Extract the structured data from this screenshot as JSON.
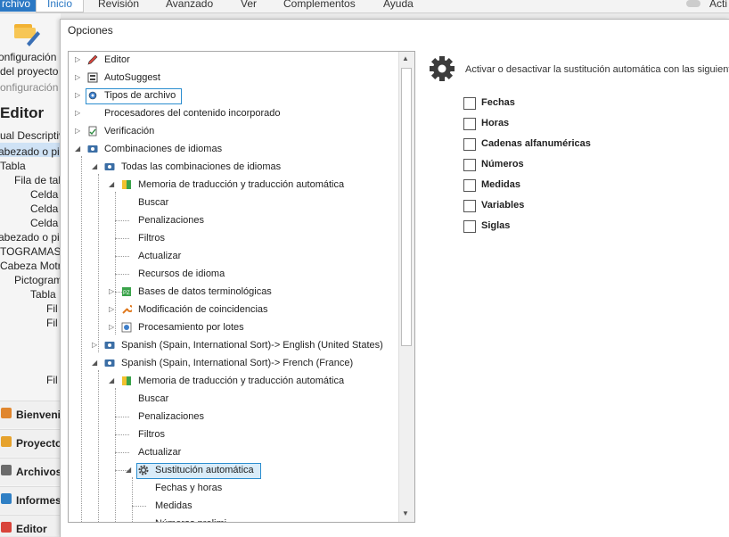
{
  "ribbon": {
    "tabs": [
      "rchivo",
      "Inicio",
      "Revisión",
      "Avanzado",
      "Ver",
      "Complementos",
      "Ayuda"
    ],
    "right_label": "Acti"
  },
  "background": {
    "lines": [
      "onfiguración",
      "del proyecto",
      "onfiguración",
      "Editor",
      "ual Descriptiv",
      "abezado o pie",
      "Tabla",
      "Fila de tab",
      "Celda",
      "Celda",
      "Celda",
      "abezado o pie",
      "TOGRAMAS",
      "Cabeza Motriz",
      "Pictogram",
      "Tabla",
      "Fil",
      "Fil",
      "Fil"
    ],
    "nav": [
      "Bienveni",
      "Proyecto",
      "Archivos",
      "Informes",
      "Editor"
    ]
  },
  "dialog": {
    "title": "Opciones",
    "tree": [
      {
        "label": "Editor",
        "icon": "pencil-icon"
      },
      {
        "label": "AutoSuggest",
        "icon": "autosuggest-icon"
      },
      {
        "label": "Tipos de archivo",
        "icon": "filetype-gear-icon"
      },
      {
        "label": "Procesadores del contenido incorporado",
        "icon": "blank-icon"
      },
      {
        "label": "Verificación",
        "icon": "check-doc-icon"
      },
      {
        "label": "Combinaciones de idiomas",
        "icon": "language-pair-icon"
      },
      {
        "label": "Todas las combinaciones de idiomas",
        "icon": "language-pair-icon"
      },
      {
        "label": "Memoria de traducción y traducción automática",
        "icon": "tm-icon"
      },
      {
        "label": "Buscar",
        "icon": ""
      },
      {
        "label": "Penalizaciones",
        "icon": ""
      },
      {
        "label": "Filtros",
        "icon": ""
      },
      {
        "label": "Actualizar",
        "icon": ""
      },
      {
        "label": "Recursos de idioma",
        "icon": ""
      },
      {
        "label": "Bases de datos terminológicas",
        "icon": "termbase-icon"
      },
      {
        "label": "Modificación de coincidencias",
        "icon": "wrench-icon"
      },
      {
        "label": "Procesamiento por lotes",
        "icon": "batch-gear-icon"
      },
      {
        "label": "Spanish (Spain, International Sort)-> English (United States)",
        "icon": "language-pair-icon"
      },
      {
        "label": "Spanish (Spain, International Sort)-> French (France)",
        "icon": "language-pair-icon"
      },
      {
        "label": "Memoria de traducción y traducción automática",
        "icon": "tm-icon"
      },
      {
        "label": "Buscar",
        "icon": ""
      },
      {
        "label": "Penalizaciones",
        "icon": ""
      },
      {
        "label": "Filtros",
        "icon": ""
      },
      {
        "label": "Actualizar",
        "icon": ""
      },
      {
        "label": "Sustitución automática",
        "icon": "gear-icon"
      },
      {
        "label": "Fechas y horas",
        "icon": ""
      },
      {
        "label": "Medidas",
        "icon": ""
      },
      {
        "label": "Números prelimi",
        "icon": ""
      }
    ],
    "panel": {
      "intro": "Activar o desactivar la sustitución automática con las siguient",
      "options": [
        {
          "label": "Fechas",
          "checked": false
        },
        {
          "label": "Horas",
          "checked": false
        },
        {
          "label": "Cadenas alfanuméricas",
          "checked": false
        },
        {
          "label": "Números",
          "checked": false
        },
        {
          "label": "Medidas",
          "checked": false
        },
        {
          "label": "Variables",
          "checked": false
        },
        {
          "label": "Siglas",
          "checked": false
        }
      ]
    }
  }
}
